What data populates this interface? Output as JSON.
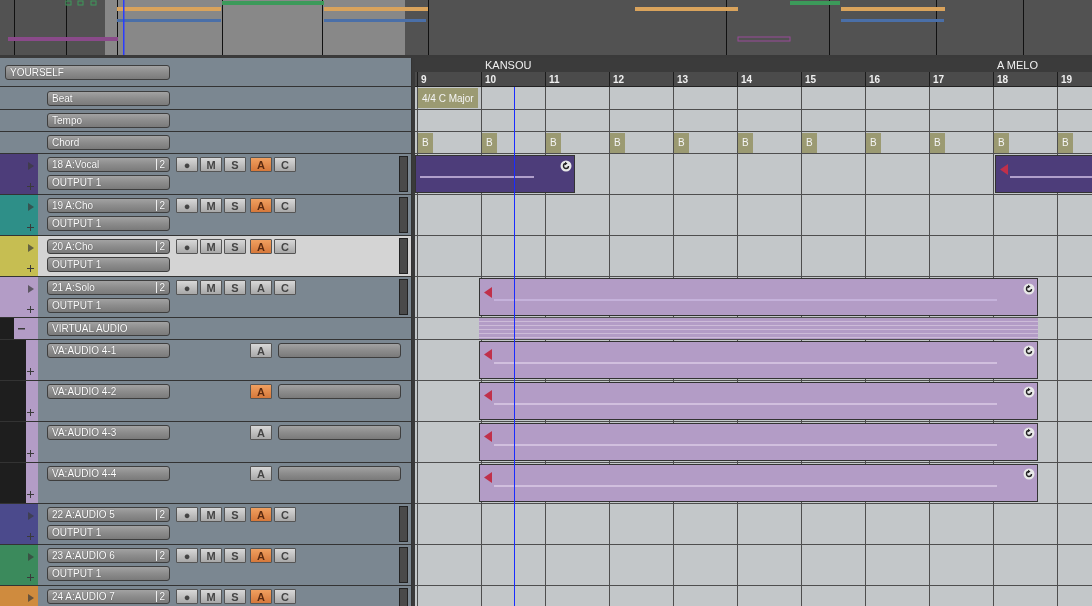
{
  "project": {
    "title": "YOURSELF"
  },
  "ruler": {
    "bars": [
      {
        "number": "9",
        "time_signature": "4/4 C Major",
        "chord": "B"
      },
      {
        "number": "10",
        "marker": "KANSOU",
        "chord": "B"
      },
      {
        "number": "11",
        "chord": "B"
      },
      {
        "number": "12",
        "chord": "B"
      },
      {
        "number": "13",
        "chord": "B"
      },
      {
        "number": "14",
        "chord": "B"
      },
      {
        "number": "15",
        "chord": "B"
      },
      {
        "number": "16",
        "chord": "B"
      },
      {
        "number": "17",
        "chord": "B"
      },
      {
        "number": "18",
        "marker": "A MELO",
        "chord": "B"
      },
      {
        "number": "19",
        "chord": "B"
      }
    ]
  },
  "global_tracks": [
    {
      "kind": "beat",
      "name": "Beat"
    },
    {
      "kind": "tempo",
      "name": "Tempo"
    },
    {
      "kind": "chord",
      "name": "Chord"
    }
  ],
  "tracks": [
    {
      "name": "18 A:Vocal",
      "channels": "2",
      "output": "OUTPUT 1",
      "color": "#4d3d7a",
      "selected": false,
      "buttons": [
        {
          "label": "●",
          "on": false
        },
        {
          "label": "M",
          "on": false
        },
        {
          "label": "S",
          "on": false
        },
        {
          "label": "A",
          "on": true
        },
        {
          "label": "C",
          "on": false
        }
      ]
    },
    {
      "name": "19 A:Cho",
      "channels": "2",
      "output": "OUTPUT 1",
      "color": "#2e8f88",
      "selected": false,
      "buttons": [
        {
          "label": "●",
          "on": false
        },
        {
          "label": "M",
          "on": false
        },
        {
          "label": "S",
          "on": false
        },
        {
          "label": "A",
          "on": true
        },
        {
          "label": "C",
          "on": false
        }
      ]
    },
    {
      "name": "20 A:Cho",
      "channels": "2",
      "output": "OUTPUT 1",
      "color": "#c6be52",
      "selected": true,
      "buttons": [
        {
          "label": "●",
          "on": false
        },
        {
          "label": "M",
          "on": false
        },
        {
          "label": "S",
          "on": false
        },
        {
          "label": "A",
          "on": true
        },
        {
          "label": "C",
          "on": false
        }
      ]
    },
    {
      "name": "21 A:Solo",
      "channels": "2",
      "output": "OUTPUT 1",
      "color": "#b39cc6",
      "selected": false,
      "buttons": [
        {
          "label": "●",
          "on": false
        },
        {
          "label": "M",
          "on": false
        },
        {
          "label": "S",
          "on": false
        },
        {
          "label": "A",
          "on": false
        },
        {
          "label": "C",
          "on": false
        }
      ],
      "virtual_audio": {
        "label": "VIRTUAL AUDIO",
        "expanded": true,
        "tracks": [
          {
            "name": "VA:AUDIO 4-1",
            "buttons": [
              {
                "label": "A",
                "on": false
              }
            ]
          },
          {
            "name": "VA:AUDIO 4-2",
            "buttons": [
              {
                "label": "A",
                "on": true
              }
            ]
          },
          {
            "name": "VA:AUDIO 4-3",
            "buttons": [
              {
                "label": "A",
                "on": false
              }
            ]
          },
          {
            "name": "VA:AUDIO 4-4",
            "buttons": [
              {
                "label": "A",
                "on": false
              }
            ]
          }
        ]
      }
    },
    {
      "name": "22 A:AUDIO 5",
      "channels": "2",
      "output": "OUTPUT 1",
      "color": "#4b4a8c",
      "selected": false,
      "buttons": [
        {
          "label": "●",
          "on": false
        },
        {
          "label": "M",
          "on": false
        },
        {
          "label": "S",
          "on": false
        },
        {
          "label": "A",
          "on": true
        },
        {
          "label": "C",
          "on": false
        }
      ]
    },
    {
      "name": "23 A:AUDIO 6",
      "channels": "2",
      "output": "OUTPUT 1",
      "color": "#3b8a5c",
      "selected": false,
      "buttons": [
        {
          "label": "●",
          "on": false
        },
        {
          "label": "M",
          "on": false
        },
        {
          "label": "S",
          "on": false
        },
        {
          "label": "A",
          "on": true
        },
        {
          "label": "C",
          "on": false
        }
      ]
    },
    {
      "name": "24 A:AUDIO 7",
      "channels": "2",
      "color": "#cf8b3e",
      "selected": false,
      "buttons": [
        {
          "label": "●",
          "on": false
        },
        {
          "label": "M",
          "on": false
        },
        {
          "label": "S",
          "on": false
        },
        {
          "label": "A",
          "on": true
        },
        {
          "label": "C",
          "on": false
        }
      ]
    }
  ]
}
